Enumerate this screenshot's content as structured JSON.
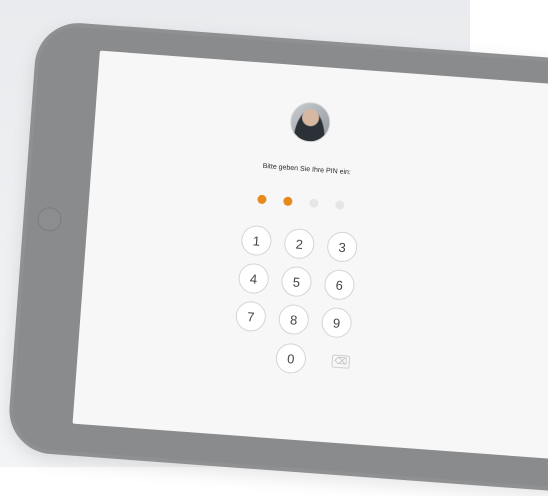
{
  "prompt": "Bitte geben Sie Ihre PIN ein:",
  "pin": {
    "filled_count": 2,
    "total_count": 4
  },
  "keys": {
    "k1": "1",
    "k2": "2",
    "k3": "3",
    "k4": "4",
    "k5": "5",
    "k6": "6",
    "k7": "7",
    "k8": "8",
    "k9": "9",
    "k0": "0"
  },
  "icons": {
    "delete": "⌫"
  },
  "colors": {
    "accent_dot": "#e78a1d",
    "empty_dot": "#e6e6e6",
    "device_frame": "#8f9092"
  }
}
